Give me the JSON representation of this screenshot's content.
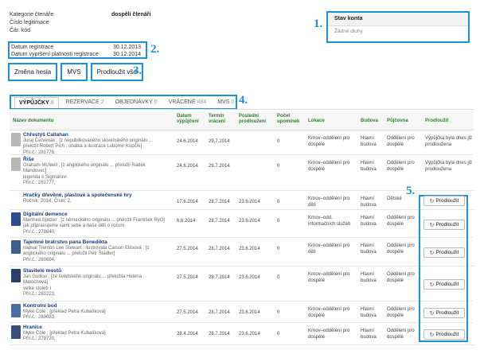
{
  "info": {
    "rows": [
      {
        "k": "Kategorie čtenáře",
        "v": "dospělí čtenáři"
      },
      {
        "k": "Číslo legitimace",
        "v": ""
      },
      {
        "k": "Čár. kód",
        "v": ""
      }
    ],
    "dates": [
      {
        "k": "Datum registrace",
        "v": "30.12.2013"
      },
      {
        "k": "Datum vypršení platnosti registrace",
        "v": "30.12.2014"
      }
    ]
  },
  "account": {
    "title": "Stav konta",
    "value": "Žádné dluhy"
  },
  "buttons": {
    "change_password": "Změna hesla",
    "mvs": "MVS",
    "renew_all": "Prodloužit vše"
  },
  "tabs": [
    {
      "label": "VÝPŮJČKY",
      "count": "8"
    },
    {
      "label": "REZERVACE",
      "count": "2"
    },
    {
      "label": "OBJEDNÁVKY",
      "count": "0"
    },
    {
      "label": "VRÁCENÉ",
      "count": "484"
    },
    {
      "label": "MVS",
      "count": "0"
    }
  ],
  "columns": {
    "doc": "Název dokumentu",
    "loan_date": [
      "Datum",
      "výpůjčení"
    ],
    "due": [
      "Termín",
      "vrácení"
    ],
    "last_renew": [
      "Poslední",
      "prodloužení"
    ],
    "reminders": [
      "Počet",
      "upomínek"
    ],
    "location": "Lokace",
    "building": "Budova",
    "branch": "Půjčovna",
    "renew": "Prodloužit"
  },
  "callouts": {
    "c1": "1.",
    "c2": "2.",
    "c3": "3.",
    "c4": "4.",
    "c5": "5."
  },
  "rows": [
    {
      "title": "Chřestýš Callahan",
      "l1": "Juraj Červenák ; [z nepublikovaného slovenského originálu ...",
      "l2": "přeložil Robert Pich ; obálka a ilustrace Lubomír Kupčík]",
      "l3": "Přír.č.: 281778,",
      "l4": "",
      "loan": "24.6.2014",
      "due": "29.7.2014",
      "last": "",
      "rem": "0",
      "loc1": "Krnov–oddělení pro",
      "loc2": "dospělé",
      "bld1": "Hlavní",
      "bld2": "budova",
      "br1": "Oddělení pro",
      "br2": "dospělé",
      "note1": "Výpůjčka byla dnes již",
      "note2": "prodloužena",
      "renew": ""
    },
    {
      "title": "Řiše",
      "l1": "Graham McNeill ; [z anglického originálu ... přeložil Radek",
      "l2": "Mandovec]",
      "l3": "legenda o Sigmarovi",
      "l4": "Přír.č.: 281777,",
      "loan": "24.6.2014",
      "due": "29.7.2014",
      "last": "",
      "rem": "0",
      "loc1": "Krnov–oddělení pro",
      "loc2": "dospělé",
      "bld1": "Hlavní",
      "bld2": "budova",
      "br1": "Oddělení pro",
      "br2": "dospělé",
      "note1": "Výpůjčka byla dnes již",
      "note2": "prodloužena",
      "renew": ""
    },
    {
      "title": "Hračky dřevěné, plastové a společenské hry",
      "l1": "Ročník: 2014, Číslo: 2,",
      "l2": "",
      "l3": "",
      "l4": "",
      "loan": "17.6.2014",
      "due": "28.7.2014",
      "last": "23.6.2014",
      "rem": "0",
      "loc1": "Krnov–oddělení pro",
      "loc2": "děti",
      "bld1": "Hlavní",
      "bld2": "budova",
      "br1": "Dětské",
      "br2": "",
      "note1": "",
      "note2": "",
      "renew": "Prodloužit"
    },
    {
      "title": "Digitální demence",
      "l1": "Manfred Spitzer ; [z německého originálu ... přeložil František Ryčl]",
      "l2": "jak připravujeme sami sebe a naše děti o rozum",
      "l3": "Přír.č.: 279840,",
      "l4": "",
      "loan": "6.6.2014",
      "due": "28.7.2014",
      "last": "23.6.2014",
      "rem": "0",
      "loc1": "Krnov–odd.",
      "loc2": "informačních služeb",
      "bld1": "Hlavní",
      "bld2": "budova",
      "br1": "Oddělení pro",
      "br2": "dospělé",
      "note1": "",
      "note2": "",
      "renew": "Prodloužit"
    },
    {
      "title": "Tajemné bratrstvo pana Benedikta",
      "l1": "napsal Trenton Lee Stewart ; ilustrovala Carson Ellisová ; [z",
      "l2": "anglického originálu ... přeložil Petr Štádler]",
      "l3": "Přír.č.: 280694,",
      "l4": "",
      "loan": "27.5.2014",
      "due": "28.7.2014",
      "last": "23.6.2014",
      "rem": "0",
      "loc1": "Krnov–oddělení pro",
      "loc2": "děti",
      "bld1": "Hlavní",
      "bld2": "budova",
      "br1": "Oddělení pro",
      "br2": "dospělé",
      "note1": "",
      "note2": "",
      "renew": "Prodloužit"
    },
    {
      "title": "Stavitelé mostů",
      "l1": "Jan Guillou ; [ze švédského originálu ... přeložila Helena",
      "l2": "Matochová]",
      "l3": "velké století I",
      "l4": "Přír.č.: 280223,",
      "loan": "27.5.2014",
      "due": "28.7.2014",
      "last": "23.6.2014",
      "rem": "0",
      "loc1": "Krnov–oddělení pro",
      "loc2": "dospělé",
      "bld1": "Hlavní",
      "bld2": "budova",
      "br1": "Oddělení pro",
      "br2": "dospělé",
      "note1": "",
      "note2": "",
      "renew": "Prodloužit"
    },
    {
      "title": "Kontrolní bod",
      "l1": "Myke Cole ; [překlad Petra Kubašková]",
      "l2": "Přír.č.: 280083,",
      "l3": "",
      "l4": "",
      "loan": "27.5.2014",
      "due": "28.7.2014",
      "last": "23.6.2014",
      "rem": "0",
      "loc1": "Krnov–oddělení pro",
      "loc2": "dospělé",
      "bld1": "Hlavní",
      "bld2": "budova",
      "br1": "Oddělení pro",
      "br2": "dospělé",
      "note1": "",
      "note2": "",
      "renew": "Prodloužit"
    },
    {
      "title": "Hranice",
      "l1": "Myke Cole ; [překlad Petra Kubašková]",
      "l2": "Přír.č.: 279720,",
      "l3": "",
      "l4": "",
      "loan": "28.4.2014",
      "due": "28.7.2014",
      "last": "23.6.2014",
      "rem": "0",
      "loc1": "Krnov–oddělení pro",
      "loc2": "dospělé",
      "bld1": "Hlavní",
      "bld2": "budova",
      "br1": "Oddělení pro",
      "br2": "dospělé",
      "note1": "",
      "note2": "",
      "renew": "Prodloužit"
    }
  ],
  "cover_colors": [
    "#b8b8b8",
    "#b8b8b8",
    "",
    "#2a4b8d",
    "#3b5f8a",
    "#2c3e66",
    "#4a6fa5",
    "#3a4e7a"
  ]
}
